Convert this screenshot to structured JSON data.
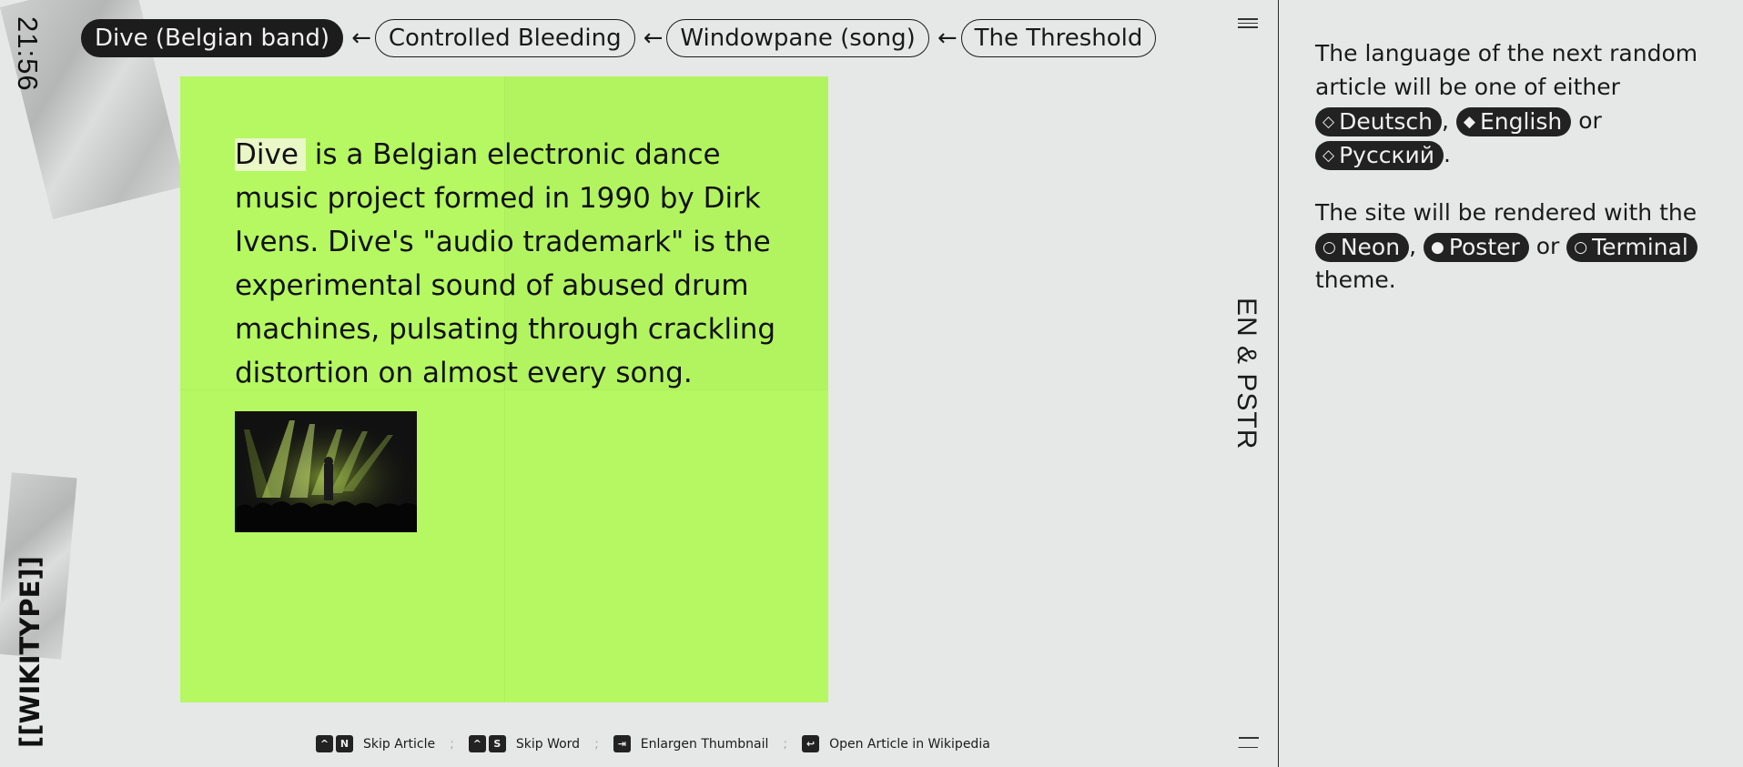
{
  "clock": {
    "time": "21:56"
  },
  "logo": {
    "text": "[[WIKITYPE]]"
  },
  "breadcrumb": {
    "arrow": "←",
    "items": [
      {
        "label": "Dive (Belgian band)",
        "active": true
      },
      {
        "label": "Controlled Bleeding",
        "active": false
      },
      {
        "label": "Windowpane (song)",
        "active": false
      },
      {
        "label": "The Threshold",
        "active": false
      }
    ]
  },
  "vertical_label": {
    "text": "EN & PSTR"
  },
  "article": {
    "highlighted_word": "Dive",
    "body": "is a Belgian electronic dance music project formed in 1990 by Dirk Ivens. Dive's \"audio trademark\" is the experimental sound of abused drum machines, pulsating through crackling distortion on almost every song.",
    "card_color": "#b5f862"
  },
  "shortcuts": [
    {
      "keys": [
        "^",
        "N"
      ],
      "label": "Skip Article"
    },
    {
      "keys": [
        "^",
        "S"
      ],
      "label": "Skip Word"
    },
    {
      "keys": [
        "⇥"
      ],
      "label": "Enlargen Thumbnail"
    },
    {
      "keys": [
        "↩"
      ],
      "label": "Open Article in Wikipedia"
    }
  ],
  "shortcut_separator": ";",
  "settings": {
    "language_intro": "The language of the next random article will be one of either",
    "languages": [
      {
        "icon": "◇",
        "label": "Deutsch"
      },
      {
        "icon": "◆",
        "label": "English"
      },
      {
        "icon": "◇",
        "label": "Русский"
      }
    ],
    "comma": ",",
    "or": "or",
    "period": ".",
    "theme_intro": "The site will be rendered with the",
    "themes": [
      {
        "icon": "○",
        "label": "Neon"
      },
      {
        "icon": "●",
        "label": "Poster"
      },
      {
        "icon": "○",
        "label": "Terminal"
      }
    ],
    "theme_outro": "theme."
  }
}
